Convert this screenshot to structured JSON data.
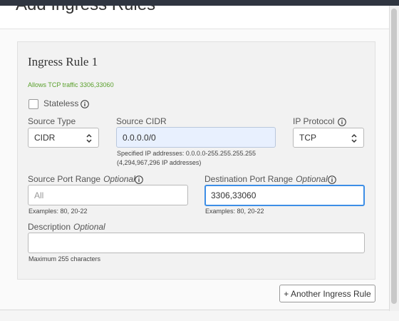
{
  "dialog": {
    "title": "Add Ingress Rules"
  },
  "rule": {
    "title": "Ingress Rule 1",
    "summary": "Allows TCP traffic 3306,33060",
    "stateless_label": "Stateless",
    "stateless_checked": false
  },
  "fields": {
    "source_type": {
      "label": "Source Type",
      "value": "CIDR"
    },
    "source_cidr": {
      "label": "Source CIDR",
      "value": "0.0.0.0/0",
      "help_line1": "Specified IP addresses: 0.0.0.0-255.255.255.255",
      "help_line2": "(4,294,967,296 IP addresses)"
    },
    "ip_protocol": {
      "label": "IP Protocol",
      "value": "TCP"
    },
    "source_port_range": {
      "label": "Source Port Range",
      "optional": "Optional",
      "placeholder": "All",
      "help": "Examples: 80, 20-22"
    },
    "destination_port_range": {
      "label": "Destination Port Range",
      "optional": "Optional",
      "value": "3306,33060",
      "help": "Examples: 80, 20-22"
    },
    "description": {
      "label": "Description",
      "optional": "Optional",
      "value": "",
      "help": "Maximum 255 characters"
    }
  },
  "actions": {
    "add_rule_label": "+ Another Ingress Rule"
  },
  "colors": {
    "summary_green": "#5aa02c",
    "focus_blue": "#3d8ee6",
    "autofill_blue": "#e8f0fe"
  },
  "icons": {
    "info": "info-icon",
    "select": "select-arrows-icon"
  }
}
